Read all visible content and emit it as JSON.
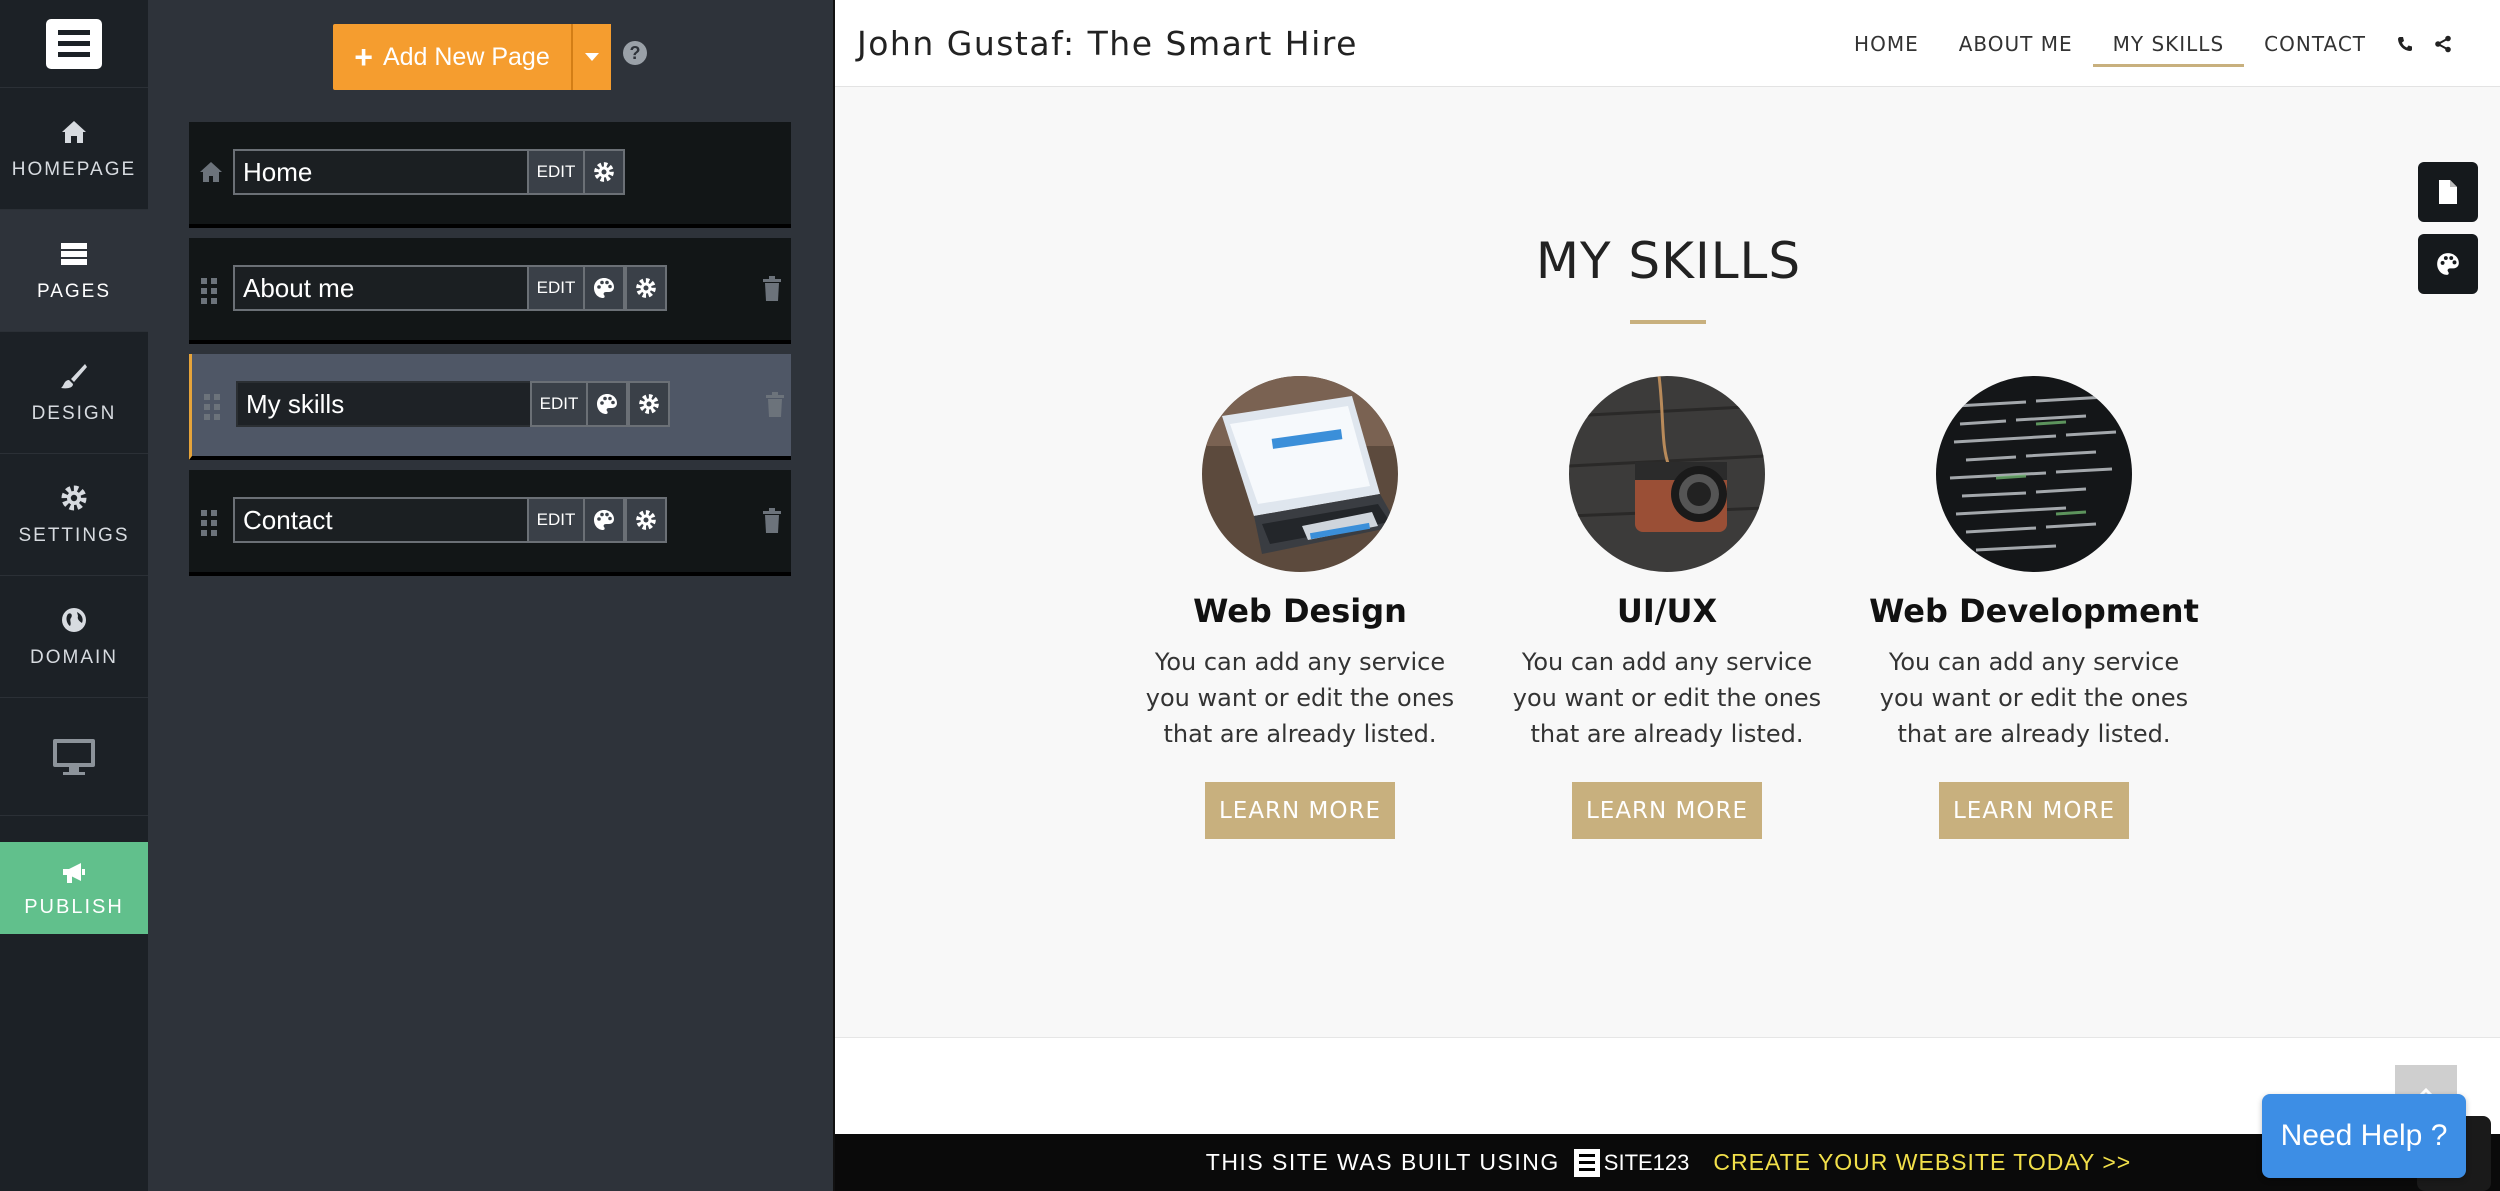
{
  "leftnav": {
    "items": [
      {
        "label": "HOMEPAGE",
        "icon": "home-icon"
      },
      {
        "label": "PAGES",
        "icon": "pages-icon"
      },
      {
        "label": "DESIGN",
        "icon": "brush-icon"
      },
      {
        "label": "SETTINGS",
        "icon": "gear-icon"
      },
      {
        "label": "DOMAIN",
        "icon": "globe-icon"
      }
    ],
    "device_icon": "desktop-icon",
    "publish_label": "PUBLISH",
    "publish_color": "#61c08c"
  },
  "pages_panel": {
    "add_label": "Add New Page",
    "accent": "#f59d2f",
    "edit_label": "EDIT",
    "pages": [
      {
        "name": "Home"
      },
      {
        "name": "About me"
      },
      {
        "name": "My skills"
      },
      {
        "name": "Contact"
      }
    ]
  },
  "site": {
    "title": "John Gustaf: The Smart Hire",
    "menu": [
      "HOME",
      "ABOUT ME",
      "MY SKILLS",
      "CONTACT"
    ],
    "accent": "#c8b07e",
    "section_title": "MY SKILLS",
    "cards": [
      {
        "title": "Web Design",
        "desc": "You can add any service you want or edit the ones that are already listed.",
        "button": "LEARN MORE"
      },
      {
        "title": "UI/UX",
        "desc": "You can add any service you want or edit the ones that are already listed.",
        "button": "LEARN MORE"
      },
      {
        "title": "Web Development",
        "desc": "You can add any service you want or edit the ones that are already listed.",
        "button": "LEARN MORE"
      }
    ]
  },
  "footer": {
    "built_text": "THIS SITE WAS BUILT USING",
    "brand": "SITE123",
    "cta": "CREATE YOUR WEBSITE TODAY >>"
  },
  "help": {
    "label": "Need Help ?"
  }
}
